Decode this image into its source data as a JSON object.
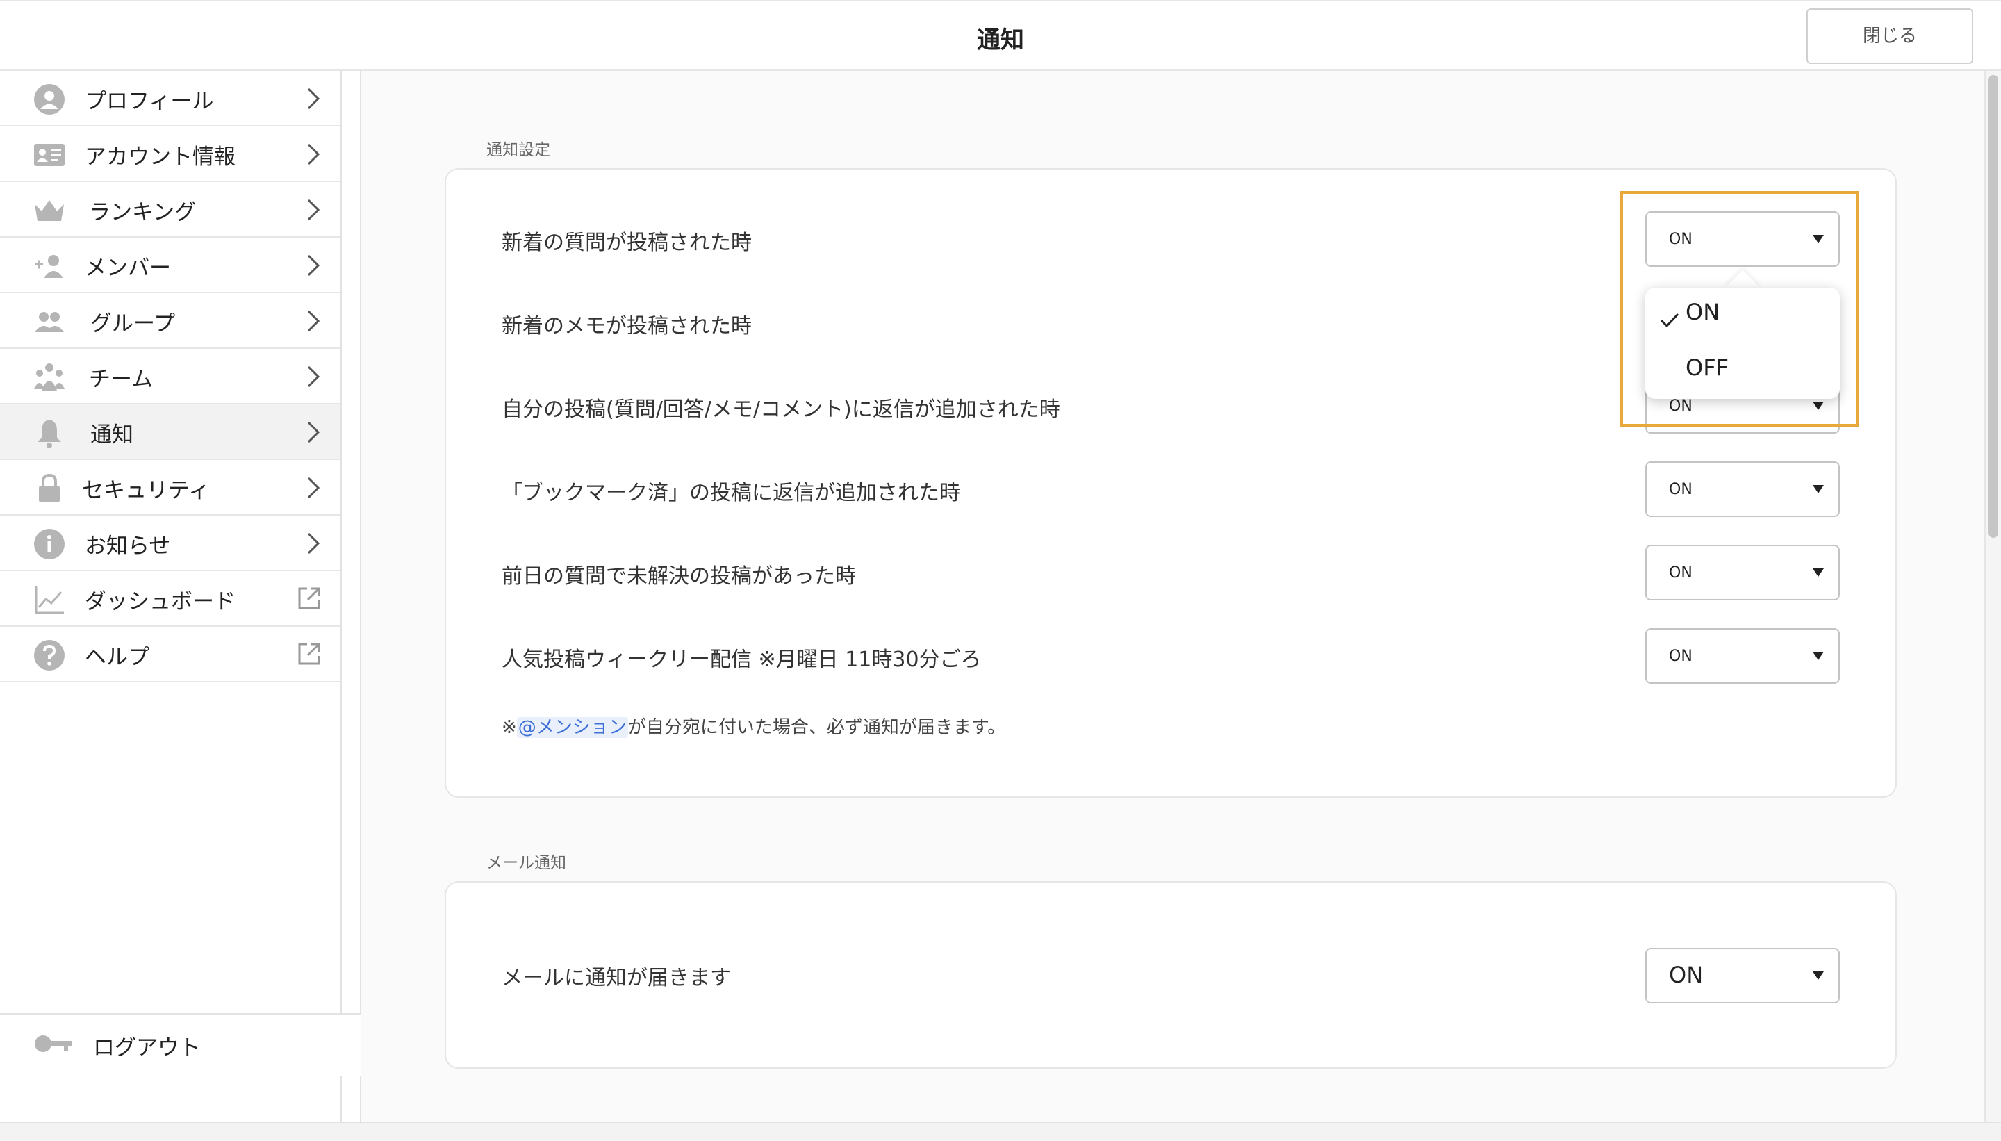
{
  "header": {
    "title": "通知",
    "close_label": "閉じる"
  },
  "sidebar": {
    "items": [
      {
        "label": "プロフィール",
        "icon": "profile-icon"
      },
      {
        "label": "アカウント情報",
        "icon": "id-card-icon"
      },
      {
        "label": "ランキング",
        "icon": "crown-icon"
      },
      {
        "label": "メンバー",
        "icon": "add-member-icon"
      },
      {
        "label": "グループ",
        "icon": "group-icon"
      },
      {
        "label": "チーム",
        "icon": "team-icon"
      },
      {
        "label": "通知",
        "icon": "bell-icon",
        "active": true
      },
      {
        "label": "セキュリティ",
        "icon": "lock-icon"
      },
      {
        "label": "お知らせ",
        "icon": "info-icon"
      },
      {
        "label": "ダッシュボード",
        "icon": "chart-icon",
        "external": true
      },
      {
        "label": "ヘルプ",
        "icon": "help-icon",
        "external": true
      }
    ],
    "logout_label": "ログアウト"
  },
  "notification_settings": {
    "section_title": "通知設定",
    "rows": [
      {
        "label": "新着の質問が投稿された時",
        "value": "ON"
      },
      {
        "label": "新着のメモが投稿された時",
        "value": "ON"
      },
      {
        "label": "自分の投稿(質問/回答/メモ/コメント)に返信が追加された時",
        "value": "ON"
      },
      {
        "label": "「ブックマーク済」の投稿に返信が追加された時",
        "value": "ON"
      },
      {
        "label": "前日の質問で未解決の投稿があった時",
        "value": "ON"
      },
      {
        "label": "人気投稿ウィークリー配信 ※月曜日 11時30分ごろ",
        "value": "ON"
      }
    ],
    "note_prefix": "※",
    "note_mention": "@メンション",
    "note_suffix": "が自分宛に付いた場合、必ず通知が届きます。"
  },
  "dropdown": {
    "options": [
      "ON",
      "OFF"
    ],
    "selected": "ON"
  },
  "mail_settings": {
    "section_title": "メール通知",
    "label": "メールに通知が届きます",
    "value": "ON"
  },
  "colors": {
    "accent": "#e8a93a",
    "mention": "#3d6fd6",
    "active_bg": "#f2f2f2"
  }
}
